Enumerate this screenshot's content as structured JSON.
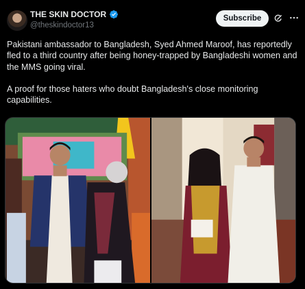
{
  "account": {
    "display_name": "THE SKIN DOCTOR",
    "handle": "@theskindoctor13",
    "verified_color": "#1d9bf0"
  },
  "actions": {
    "subscribe_label": "Subscribe",
    "grok_icon": "grok-icon",
    "more_icon": "more-icon"
  },
  "tweet": {
    "paragraph_1": "Pakistani ambassador to Bangladesh, Syed Ahmed Maroof, has reportedly fled to a third country after being honey-trapped by Bangladeshi women and the MMS going viral.",
    "paragraph_2": "A proof for those haters who doubt Bangladesh's close monitoring capabilities."
  },
  "media": {
    "images": [
      {
        "name": "photo-left"
      },
      {
        "name": "photo-right"
      }
    ]
  },
  "colors": {
    "background": "#000000",
    "text": "#e7e9ea",
    "muted": "#71767b",
    "accent": "#1d9bf0"
  }
}
